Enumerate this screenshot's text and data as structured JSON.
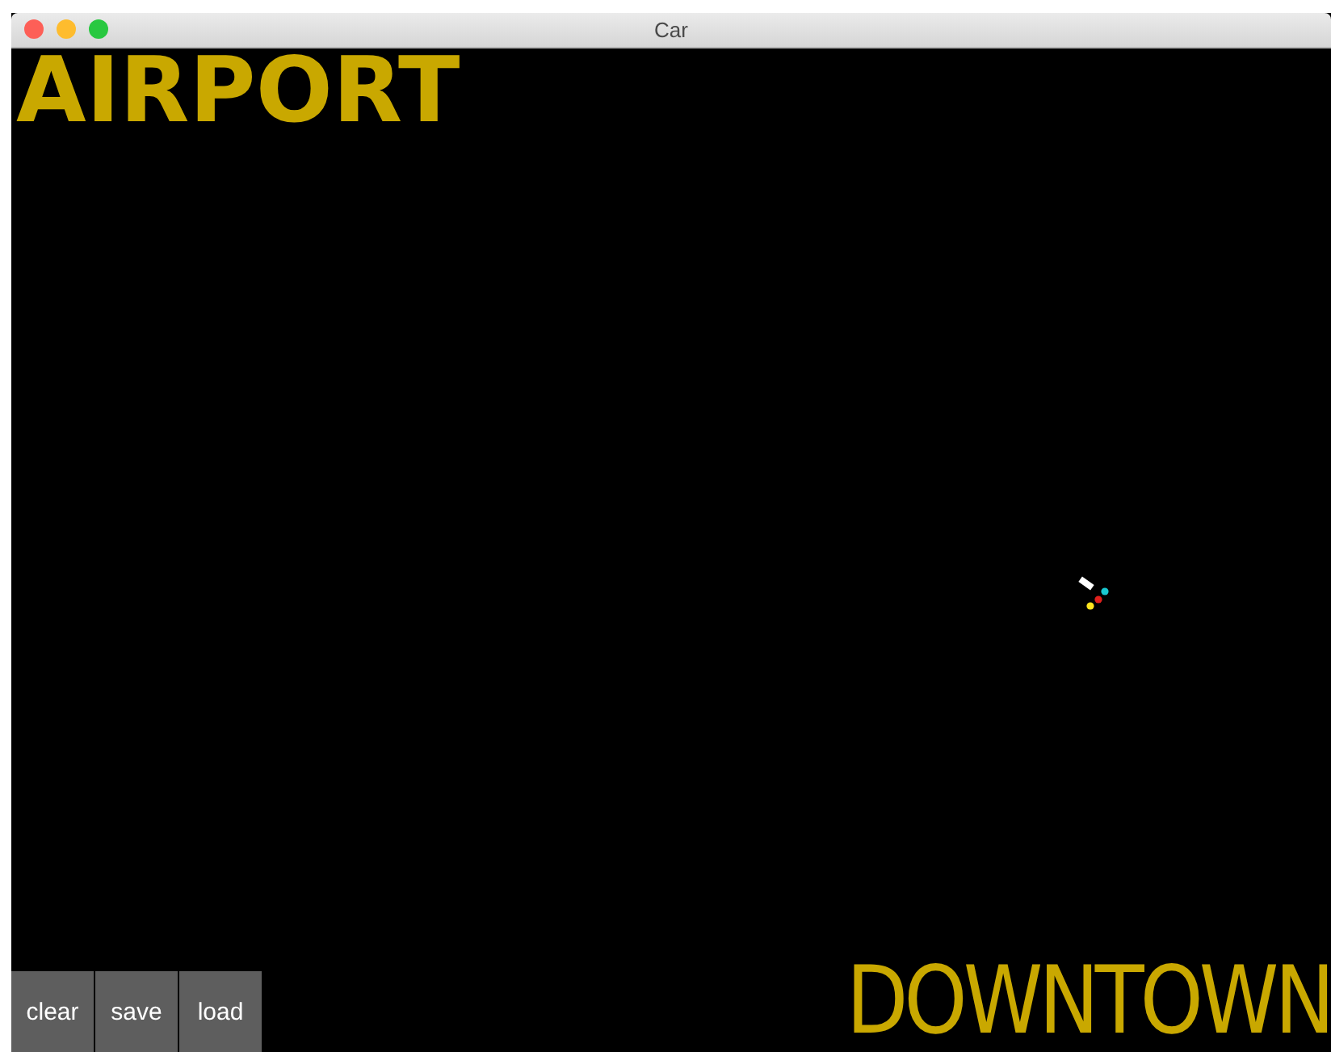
{
  "window": {
    "title": "Car"
  },
  "canvas": {
    "top_label": "AIRPORT",
    "bottom_label": "DOWNTOWN"
  },
  "buttons": [
    {
      "label": "clear"
    },
    {
      "label": "save"
    },
    {
      "label": "load"
    }
  ]
}
